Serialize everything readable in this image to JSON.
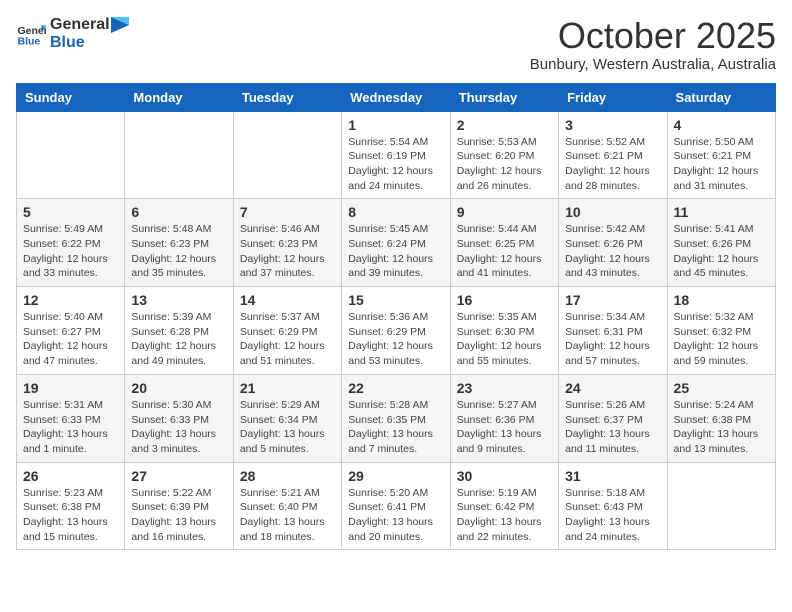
{
  "header": {
    "logo_general": "General",
    "logo_blue": "Blue",
    "title": "October 2025",
    "location": "Bunbury, Western Australia, Australia"
  },
  "days_of_week": [
    "Sunday",
    "Monday",
    "Tuesday",
    "Wednesday",
    "Thursday",
    "Friday",
    "Saturday"
  ],
  "weeks": [
    {
      "row_class": "row-odd",
      "days": [
        {
          "num": "",
          "info": "",
          "empty": true
        },
        {
          "num": "",
          "info": "",
          "empty": true
        },
        {
          "num": "",
          "info": "",
          "empty": true
        },
        {
          "num": "1",
          "info": "Sunrise: 5:54 AM\nSunset: 6:19 PM\nDaylight: 12 hours\nand 24 minutes.",
          "empty": false
        },
        {
          "num": "2",
          "info": "Sunrise: 5:53 AM\nSunset: 6:20 PM\nDaylight: 12 hours\nand 26 minutes.",
          "empty": false
        },
        {
          "num": "3",
          "info": "Sunrise: 5:52 AM\nSunset: 6:21 PM\nDaylight: 12 hours\nand 28 minutes.",
          "empty": false
        },
        {
          "num": "4",
          "info": "Sunrise: 5:50 AM\nSunset: 6:21 PM\nDaylight: 12 hours\nand 31 minutes.",
          "empty": false
        }
      ]
    },
    {
      "row_class": "row-even",
      "days": [
        {
          "num": "5",
          "info": "Sunrise: 5:49 AM\nSunset: 6:22 PM\nDaylight: 12 hours\nand 33 minutes.",
          "empty": false
        },
        {
          "num": "6",
          "info": "Sunrise: 5:48 AM\nSunset: 6:23 PM\nDaylight: 12 hours\nand 35 minutes.",
          "empty": false
        },
        {
          "num": "7",
          "info": "Sunrise: 5:46 AM\nSunset: 6:23 PM\nDaylight: 12 hours\nand 37 minutes.",
          "empty": false
        },
        {
          "num": "8",
          "info": "Sunrise: 5:45 AM\nSunset: 6:24 PM\nDaylight: 12 hours\nand 39 minutes.",
          "empty": false
        },
        {
          "num": "9",
          "info": "Sunrise: 5:44 AM\nSunset: 6:25 PM\nDaylight: 12 hours\nand 41 minutes.",
          "empty": false
        },
        {
          "num": "10",
          "info": "Sunrise: 5:42 AM\nSunset: 6:26 PM\nDaylight: 12 hours\nand 43 minutes.",
          "empty": false
        },
        {
          "num": "11",
          "info": "Sunrise: 5:41 AM\nSunset: 6:26 PM\nDaylight: 12 hours\nand 45 minutes.",
          "empty": false
        }
      ]
    },
    {
      "row_class": "row-odd",
      "days": [
        {
          "num": "12",
          "info": "Sunrise: 5:40 AM\nSunset: 6:27 PM\nDaylight: 12 hours\nand 47 minutes.",
          "empty": false
        },
        {
          "num": "13",
          "info": "Sunrise: 5:39 AM\nSunset: 6:28 PM\nDaylight: 12 hours\nand 49 minutes.",
          "empty": false
        },
        {
          "num": "14",
          "info": "Sunrise: 5:37 AM\nSunset: 6:29 PM\nDaylight: 12 hours\nand 51 minutes.",
          "empty": false
        },
        {
          "num": "15",
          "info": "Sunrise: 5:36 AM\nSunset: 6:29 PM\nDaylight: 12 hours\nand 53 minutes.",
          "empty": false
        },
        {
          "num": "16",
          "info": "Sunrise: 5:35 AM\nSunset: 6:30 PM\nDaylight: 12 hours\nand 55 minutes.",
          "empty": false
        },
        {
          "num": "17",
          "info": "Sunrise: 5:34 AM\nSunset: 6:31 PM\nDaylight: 12 hours\nand 57 minutes.",
          "empty": false
        },
        {
          "num": "18",
          "info": "Sunrise: 5:32 AM\nSunset: 6:32 PM\nDaylight: 12 hours\nand 59 minutes.",
          "empty": false
        }
      ]
    },
    {
      "row_class": "row-even",
      "days": [
        {
          "num": "19",
          "info": "Sunrise: 5:31 AM\nSunset: 6:33 PM\nDaylight: 13 hours\nand 1 minute.",
          "empty": false
        },
        {
          "num": "20",
          "info": "Sunrise: 5:30 AM\nSunset: 6:33 PM\nDaylight: 13 hours\nand 3 minutes.",
          "empty": false
        },
        {
          "num": "21",
          "info": "Sunrise: 5:29 AM\nSunset: 6:34 PM\nDaylight: 13 hours\nand 5 minutes.",
          "empty": false
        },
        {
          "num": "22",
          "info": "Sunrise: 5:28 AM\nSunset: 6:35 PM\nDaylight: 13 hours\nand 7 minutes.",
          "empty": false
        },
        {
          "num": "23",
          "info": "Sunrise: 5:27 AM\nSunset: 6:36 PM\nDaylight: 13 hours\nand 9 minutes.",
          "empty": false
        },
        {
          "num": "24",
          "info": "Sunrise: 5:26 AM\nSunset: 6:37 PM\nDaylight: 13 hours\nand 11 minutes.",
          "empty": false
        },
        {
          "num": "25",
          "info": "Sunrise: 5:24 AM\nSunset: 6:38 PM\nDaylight: 13 hours\nand 13 minutes.",
          "empty": false
        }
      ]
    },
    {
      "row_class": "row-odd",
      "days": [
        {
          "num": "26",
          "info": "Sunrise: 5:23 AM\nSunset: 6:38 PM\nDaylight: 13 hours\nand 15 minutes.",
          "empty": false
        },
        {
          "num": "27",
          "info": "Sunrise: 5:22 AM\nSunset: 6:39 PM\nDaylight: 13 hours\nand 16 minutes.",
          "empty": false
        },
        {
          "num": "28",
          "info": "Sunrise: 5:21 AM\nSunset: 6:40 PM\nDaylight: 13 hours\nand 18 minutes.",
          "empty": false
        },
        {
          "num": "29",
          "info": "Sunrise: 5:20 AM\nSunset: 6:41 PM\nDaylight: 13 hours\nand 20 minutes.",
          "empty": false
        },
        {
          "num": "30",
          "info": "Sunrise: 5:19 AM\nSunset: 6:42 PM\nDaylight: 13 hours\nand 22 minutes.",
          "empty": false
        },
        {
          "num": "31",
          "info": "Sunrise: 5:18 AM\nSunset: 6:43 PM\nDaylight: 13 hours\nand 24 minutes.",
          "empty": false
        },
        {
          "num": "",
          "info": "",
          "empty": true
        }
      ]
    }
  ]
}
